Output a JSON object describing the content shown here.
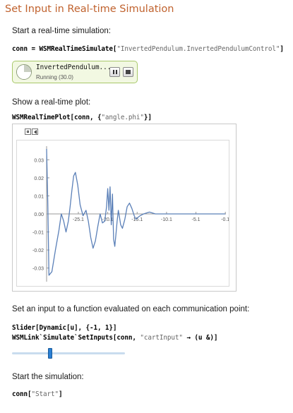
{
  "title": "Set Input in Real-time Simulation",
  "steps": {
    "start_label": "Start a real-time simulation:",
    "conn_code_prefix": "conn = WSMRealTimeSimulate[",
    "conn_code_string": "\"InvertedPendulum.InvertedPendulumControl\"",
    "conn_code_suffix": "]",
    "plot_label": "Show a real-time plot:",
    "plot_code_prefix": "WSMRealTimePlot[conn, {",
    "plot_code_string": "\"angle.phi\"",
    "plot_code_suffix": "}]",
    "input_label": "Set an input to a function evaluated on each communication point:",
    "slider_code": "Slider[Dynamic[u], {-1, 1}]",
    "setinputs_prefix": "WSMLink`Simulate`SetInputs[conn, ",
    "setinputs_string": "\"cartInput\"",
    "setinputs_suffix": " → (u &)]",
    "start_sim_label": "Start the simulation:",
    "start_code_prefix": "conn[",
    "start_code_string": "\"Start\"",
    "start_code_suffix": "]"
  },
  "simulation_panel": {
    "name": "InvertedPendulum...",
    "status": "Running (30.0)",
    "clock_icon": "clock-progress-icon",
    "pause_icon": "pause-icon",
    "stop_icon": "stop-icon",
    "border_color": "#a8c86a",
    "background_color": "#f2f8e2"
  },
  "slider": {
    "min": -1,
    "max": 1,
    "value": -0.33,
    "track_color": "#c9dcee",
    "thumb_color": "#2a7fd4"
  },
  "chart_data": {
    "type": "line",
    "title": "",
    "xlabel": "",
    "ylabel": "",
    "xlim": [
      -30.5,
      0
    ],
    "ylim": [
      -0.036,
      0.036
    ],
    "x_ticks": [
      -25.1,
      -20.1,
      -15.1,
      -10.1,
      -5.1,
      -0.1
    ],
    "x_tick_labels": [
      "-25.1",
      "-20.1",
      "-15.1",
      "-10.1",
      "-5.1",
      "-0.1"
    ],
    "y_ticks": [
      -0.03,
      -0.02,
      -0.01,
      0.0,
      0.01,
      0.02,
      0.03
    ],
    "y_tick_labels": [
      "-0.03",
      "-0.02",
      "-0.01",
      "0.00",
      "0.01",
      "0.02",
      "0.03"
    ],
    "series_color": "#5b80b8",
    "series": [
      {
        "x": [
          -30.5,
          -30.3,
          -30.1,
          -29.6,
          -29.0,
          -28.4,
          -28.0,
          -27.6,
          -27.2,
          -26.8,
          -26.5,
          -26.2,
          -25.9,
          -25.6,
          -25.2,
          -24.8,
          -24.3,
          -23.8,
          -23.4,
          -23.0,
          -22.6,
          -22.2,
          -21.8,
          -21.4,
          -21.0,
          -20.6,
          -20.3,
          -20.1,
          -19.9,
          -19.7,
          -19.5,
          -19.3,
          -19.1,
          -18.9,
          -18.7,
          -18.5,
          -18.3,
          -18.1,
          -17.9,
          -17.6,
          -17.2,
          -16.8,
          -16.4,
          -16.0,
          -15.6,
          -15.3,
          -15.0,
          -14.6,
          -14.0,
          -13.0,
          -12.0,
          -10.1,
          -8.0,
          -6.0,
          -4.0,
          -2.0,
          -0.1
        ],
        "y": [
          0.036,
          0.006,
          -0.034,
          -0.032,
          -0.02,
          -0.009,
          0.0,
          -0.004,
          -0.01,
          -0.004,
          0.004,
          0.013,
          0.021,
          0.023,
          0.016,
          0.005,
          -0.001,
          0.002,
          -0.004,
          -0.013,
          -0.019,
          -0.015,
          -0.007,
          0.0,
          -0.005,
          -0.004,
          0.004,
          0.014,
          0.002,
          0.015,
          -0.006,
          0.011,
          -0.014,
          -0.018,
          -0.011,
          -0.004,
          0.002,
          -0.002,
          -0.006,
          -0.008,
          -0.003,
          0.004,
          0.006,
          0.003,
          -0.001,
          -0.003,
          -0.002,
          -0.001,
          0.0,
          0.001,
          0.0,
          0.0,
          0.0,
          0.0,
          0.0,
          0.0,
          0.0
        ]
      }
    ]
  }
}
